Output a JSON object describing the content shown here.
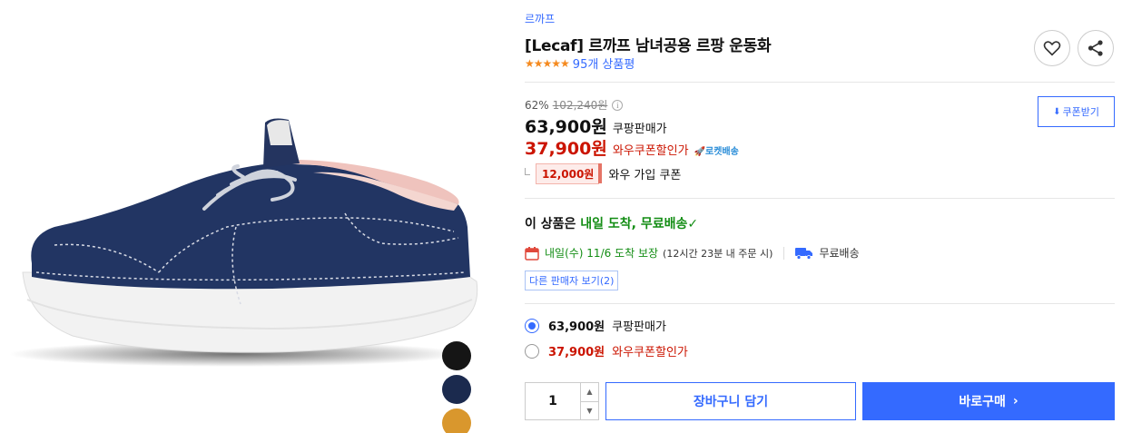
{
  "gallery": {
    "swatches": [
      {
        "name": "black",
        "color": "#151515"
      },
      {
        "name": "navy",
        "color": "#1b2a4e"
      },
      {
        "name": "mustard",
        "color": "#d9972d"
      }
    ]
  },
  "product": {
    "brand": "르까프",
    "title": "[Lecaf] 르까프 남녀공용 르팡 운동화",
    "stars": "★★★★★",
    "review_count": "95개 상품평"
  },
  "pricing": {
    "discount_rate": "62%",
    "original_price": "102,240원",
    "info_icon": "i",
    "sale_price": "63,900원",
    "sale_label": "쿠팡판매가",
    "wow_price": "37,900원",
    "wow_label": "와우쿠폰할인가",
    "rocket_label": "로켓배송",
    "coupon_amount": "12,000원",
    "coupon_label": "와우 가입 쿠폰",
    "coupon_button": "쿠폰받기"
  },
  "delivery": {
    "title_prefix": "이 상품은 ",
    "title_highlight": "내일 도착, 무료배송",
    "check": "✓",
    "arrival": "내일(수) 11/6 도착 보장",
    "arrival_note": "(12시간 23분 내 주문 시)",
    "free_shipping": "무료배송",
    "other_sellers": "다른 판매자 보기(2)"
  },
  "options": [
    {
      "price": "63,900원",
      "label": "쿠팡판매가",
      "selected": true
    },
    {
      "price": "37,900원",
      "label": "와우쿠폰할인가",
      "selected": false
    }
  ],
  "purchase": {
    "quantity": "1",
    "up": "▲",
    "down": "▼",
    "cart_label": "장바구니 담기",
    "buy_label": "바로구매",
    "buy_chevron": "›"
  },
  "colors": {
    "accent_blue": "#346aff",
    "price_red": "#cb1400",
    "delivery_green": "#138d14",
    "star_orange": "#f58a1f"
  }
}
